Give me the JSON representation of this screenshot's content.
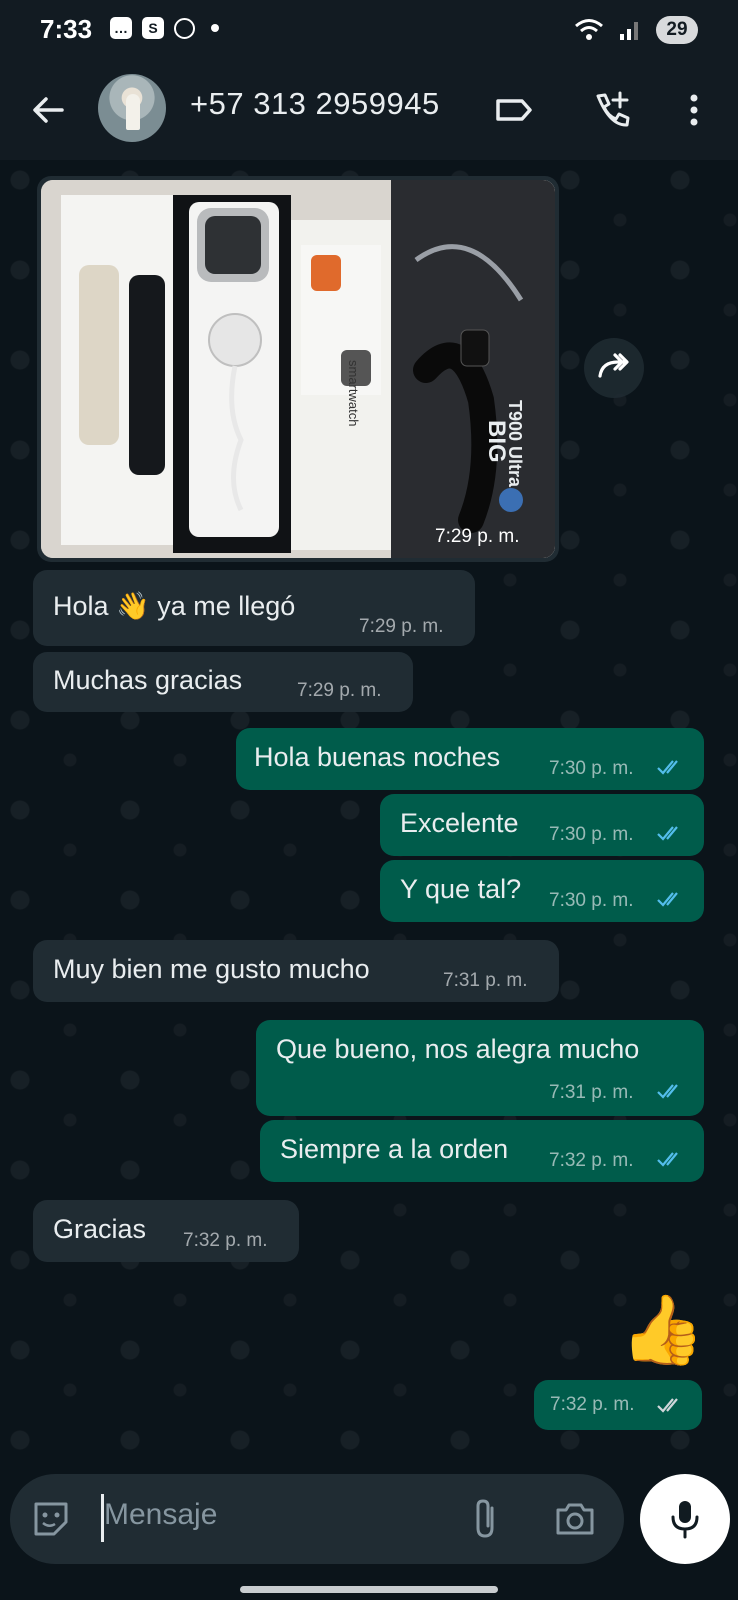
{
  "status_bar": {
    "time": "7:33",
    "left_icons": [
      "chat-icon",
      "shopify-icon",
      "openai-icon",
      "dot-icon"
    ],
    "right_icons": [
      "wifi-icon",
      "signal-icon"
    ],
    "battery": "29"
  },
  "header": {
    "contact": "+57 313 2959945",
    "icons": [
      "back-icon",
      "label-icon",
      "add-call-icon",
      "more-icon"
    ]
  },
  "image_message": {
    "time": "7:29 p. m.",
    "box_text": "T900 Ultra 2",
    "box_text_2": "BIG",
    "side_text": "smartwatch"
  },
  "messages": [
    {
      "dir": "in",
      "text": "Hola",
      "text_after": "ya me llegó",
      "emoji": "👋",
      "time": "7:29 p. m."
    },
    {
      "dir": "in",
      "text": "Muchas gracias",
      "time": "7:29 p. m."
    },
    {
      "dir": "out",
      "text": "Hola buenas noches",
      "time": "7:30 p. m."
    },
    {
      "dir": "out",
      "text": "Excelente",
      "time": "7:30 p. m."
    },
    {
      "dir": "out",
      "text": "Y que tal?",
      "time": "7:30 p. m."
    },
    {
      "dir": "in",
      "text": "Muy bien me gusto mucho",
      "time": "7:31 p. m."
    },
    {
      "dir": "out",
      "text": "Que bueno, nos alegra mucho",
      "time": "7:31 p. m."
    },
    {
      "dir": "out",
      "text": "Siempre a la orden",
      "time": "7:32 p. m."
    },
    {
      "dir": "in",
      "text": "Gracias",
      "time": "7:32 p. m."
    },
    {
      "dir": "out",
      "emoji": "👍",
      "time": "7:32 p. m."
    }
  ],
  "input": {
    "placeholder": "Mensaje",
    "icons": [
      "sticker-icon",
      "attach-icon",
      "camera-icon",
      "mic-icon"
    ]
  },
  "colors": {
    "background": "#0b141a",
    "bar": "#121b22",
    "incoming": "#202c33",
    "outgoing": "#005c4b",
    "read_ticks": "#53bdeb"
  }
}
